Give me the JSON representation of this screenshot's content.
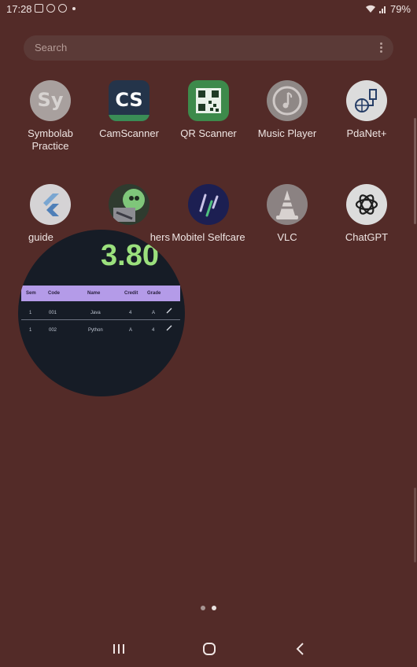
{
  "status": {
    "time": "17:28",
    "battery": "79%",
    "notification_icons": [
      "gallery-icon",
      "whatsapp-icon",
      "whatsapp-icon",
      "dot-icon"
    ],
    "system_icons": [
      "wifi-icon",
      "signal-icon"
    ]
  },
  "search": {
    "placeholder": "Search"
  },
  "apps": [
    {
      "label": "Symbolab Practice",
      "icon": "symbolab-icon",
      "glyph": "Sy"
    },
    {
      "label": "CamScanner",
      "icon": "camscanner-icon",
      "glyph": "CS"
    },
    {
      "label": "QR Scanner",
      "icon": "qr-scanner-icon"
    },
    {
      "label": "Music Player",
      "icon": "music-player-icon"
    },
    {
      "label": "PdaNet+",
      "icon": "pdanet-icon"
    },
    {
      "label": "guide",
      "icon": "flutter-icon"
    },
    {
      "label": "hers",
      "icon": "game-icon"
    },
    {
      "label": "Mobitel Selfcare",
      "icon": "mobitel-icon"
    },
    {
      "label": "VLC",
      "icon": "vlc-icon"
    },
    {
      "label": "ChatGPT",
      "icon": "chatgpt-icon"
    }
  ],
  "overlay": {
    "gpa": "3.80",
    "table": {
      "headers": [
        "Sem",
        "Code",
        "Name",
        "Credit",
        "Grade"
      ],
      "rows": [
        [
          "1",
          "001",
          "Java",
          "4",
          "A"
        ],
        [
          "1",
          "002",
          "Python",
          "A",
          "4"
        ]
      ]
    }
  },
  "pager": {
    "pages": 2,
    "active_page": 2
  },
  "colors": {
    "wallpaper": "#532b28",
    "gpa_text": "#9be07d",
    "table_header": "#b49be8"
  }
}
